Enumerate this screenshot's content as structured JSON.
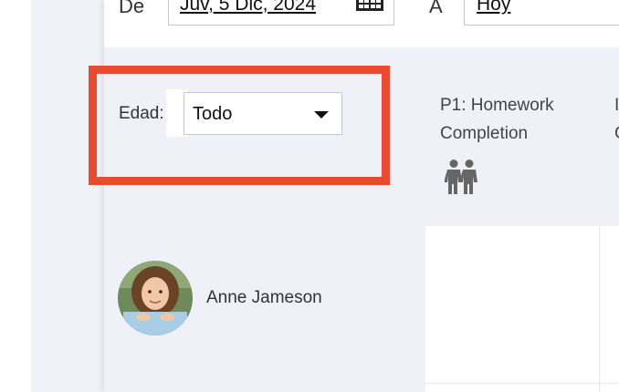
{
  "date_range": {
    "from_label": "De",
    "from_value": "Juv, 5 Dic, 2024",
    "to_label": "A",
    "to_value": "Hoy"
  },
  "filter": {
    "age_label": "Edad:",
    "age_value": "Todo"
  },
  "columns": [
    {
      "title_line1": "P1: Homework",
      "title_line2": "Completion",
      "icon": "people-icon"
    },
    {
      "title_line1": "I",
      "title_line2": "C"
    }
  ],
  "students": [
    {
      "name": "Anne Jameson",
      "avatar": "student-photo"
    }
  ],
  "colors": {
    "highlight": "#ec4a30",
    "panel_bg": "#eff0f8",
    "icon_gray": "#666666"
  }
}
